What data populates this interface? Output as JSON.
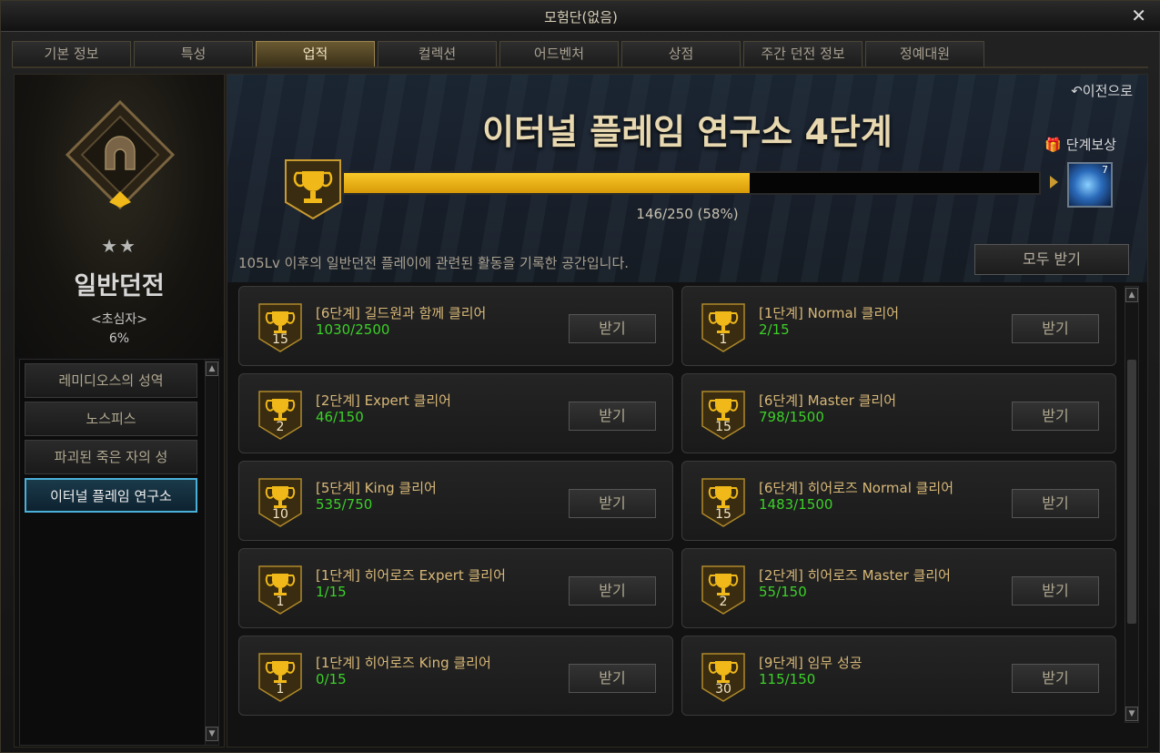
{
  "window": {
    "title": "모험단(없음)"
  },
  "tabs": [
    {
      "label": "기본 정보"
    },
    {
      "label": "특성"
    },
    {
      "label": "업적",
      "active": true
    },
    {
      "label": "컬렉션"
    },
    {
      "label": "어드벤처"
    },
    {
      "label": "상점"
    },
    {
      "label": "주간 던전 정보"
    },
    {
      "label": "정예대원"
    }
  ],
  "sidebar": {
    "stars": "★★",
    "dungeon_name": "일반던전",
    "rank": "<초심자>",
    "percent": "6%",
    "items": [
      {
        "label": "레미디오스의 성역"
      },
      {
        "label": "노스피스"
      },
      {
        "label": "파괴된 죽은 자의 성"
      },
      {
        "label": "이터널 플레임 연구소",
        "active": true
      }
    ]
  },
  "header": {
    "back_label": "이전으로",
    "title": "이터널 플레임 연구소 4단계",
    "reward_label": "단계보상",
    "reward_count": "7",
    "progress_text": "146/250 (58%)",
    "progress_fraction": 0.584,
    "description": "105Lv 이후의 일반던전 플레이에 관련된 활동을 기록한 공간입니다.",
    "claim_all_label": "모두 받기"
  },
  "colors": {
    "accent_gold": "#f0b818",
    "progress_green": "#3cd028",
    "selected_border": "#4ab0d8"
  },
  "achievements": [
    {
      "level": "15",
      "title": "[6단계] 길드원과 함께 클리어",
      "progress": "1030/2500",
      "button": "받기"
    },
    {
      "level": "1",
      "title": "[1단계] Normal 클리어",
      "progress": "2/15",
      "button": "받기"
    },
    {
      "level": "2",
      "title": "[2단계] Expert 클리어",
      "progress": "46/150",
      "button": "받기"
    },
    {
      "level": "15",
      "title": "[6단계] Master 클리어",
      "progress": "798/1500",
      "button": "받기"
    },
    {
      "level": "10",
      "title": "[5단계] King 클리어",
      "progress": "535/750",
      "button": "받기"
    },
    {
      "level": "15",
      "title": "[6단계] 히어로즈 Normal 클리어",
      "progress": "1483/1500",
      "button": "받기"
    },
    {
      "level": "1",
      "title": "[1단계] 히어로즈 Expert 클리어",
      "progress": "1/15",
      "button": "받기"
    },
    {
      "level": "2",
      "title": "[2단계] 히어로즈 Master 클리어",
      "progress": "55/150",
      "button": "받기"
    },
    {
      "level": "1",
      "title": "[1단계] 히어로즈 King 클리어",
      "progress": "0/15",
      "button": "받기"
    },
    {
      "level": "30",
      "title": "[9단계] 임무 성공",
      "progress": "115/150",
      "button": "받기"
    }
  ]
}
